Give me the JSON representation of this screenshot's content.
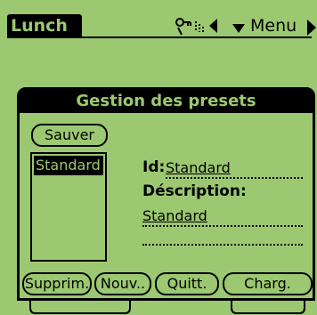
{
  "app": {
    "title": "Lunch",
    "menu_label": "Menu"
  },
  "dialog": {
    "title": "Gestion des presets",
    "save_button": "Sauver",
    "presets": [
      "Standard"
    ],
    "fields": {
      "id_label": "Id:",
      "id_value": "Standard",
      "description_label": "Déscription:",
      "description_value": "Standard"
    },
    "buttons": [
      "Supprim.",
      "Nouv..",
      "Quitt.",
      "Charg."
    ]
  },
  "colors": {
    "screen": "#9bc870",
    "ink": "#000000"
  }
}
